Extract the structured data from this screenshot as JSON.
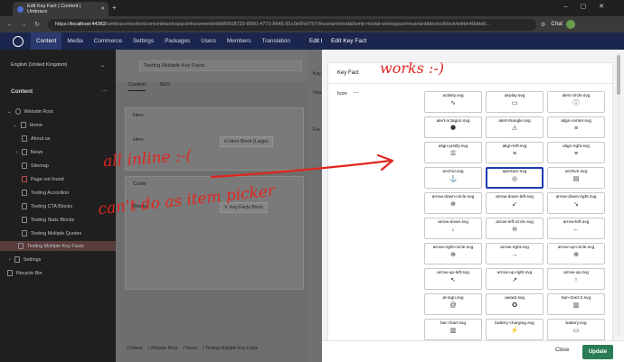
{
  "browser": {
    "tab_title": "Edit Key Fact | Content | Umbraco",
    "url_scheme": "https://",
    "url_host": "localhost:44362",
    "url_path": "/umbraco/section/content/workspace/document/edit/80508729-8560-4772-8646-81c0e5fe9707/invariant/modal/umb-modal-workspace/invariant/blocks/block/edit/e40dda6...",
    "chat_label": "Chat"
  },
  "header": {
    "sections": [
      "Content",
      "Media",
      "Commerce",
      "Settings",
      "Packages",
      "Users",
      "Members",
      "Translation"
    ],
    "active_section": "Content",
    "underlying_title": "Edit K"
  },
  "tree": {
    "culture": "English (United Kingdom)",
    "title": "Content",
    "nodes": [
      {
        "label": "Website Root",
        "level": 0
      },
      {
        "label": "Home",
        "level": 1
      },
      {
        "label": "About us",
        "level": 2
      },
      {
        "label": "News",
        "level": 2
      },
      {
        "label": "Sitemap",
        "level": 2
      },
      {
        "label": "Page not found",
        "level": 2
      },
      {
        "label": "Testing Accordion",
        "level": 2
      },
      {
        "label": "Testing CTA Blocks",
        "level": 2
      },
      {
        "label": "Testing Stats Blocks",
        "level": 2
      },
      {
        "label": "Testing Multiple Quotes",
        "level": 2
      },
      {
        "label": "Testing Multiple Key Facts",
        "level": 2
      },
      {
        "label": "Settings",
        "level": 1
      },
      {
        "label": "Recycle Bin",
        "level": 0
      }
    ],
    "selected": "Testing Multiple Key Facts"
  },
  "editor": {
    "document_name": "Testing Multiple Key Facts",
    "tabs": [
      "Content",
      "SEO"
    ],
    "hero_group": "Hero",
    "hero_label": "Hero",
    "hero_block": "Hero Block (Large)",
    "content_group": "Conte",
    "blocks_label": "Blocks",
    "blocks_block": "Key Facts Block",
    "breadcrumbs": [
      "Content",
      "Website Root",
      "Home",
      "Testing Multiple Key Facts"
    ],
    "right_labels": [
      "Key",
      "Hea",
      "Fac"
    ]
  },
  "modal": {
    "title": "Edit Key Fact",
    "card_title": "Key Fact",
    "icon_label": "Icon",
    "icons": [
      {
        "name": "activity.svg",
        "glyph": "∿"
      },
      {
        "name": "airplay.svg",
        "glyph": "▭"
      },
      {
        "name": "alert-circle.svg",
        "glyph": "ⓘ"
      },
      {
        "name": "alert-octagon.svg",
        "glyph": "⯃"
      },
      {
        "name": "alert-triangle.svg",
        "glyph": "⚠"
      },
      {
        "name": "align-center.svg",
        "glyph": "≡"
      },
      {
        "name": "align-justify.svg",
        "glyph": "☰"
      },
      {
        "name": "align-left.svg",
        "glyph": "≡"
      },
      {
        "name": "align-right.svg",
        "glyph": "≡"
      },
      {
        "name": "anchor.svg",
        "glyph": "⚓"
      },
      {
        "name": "aperture.svg",
        "glyph": "◎"
      },
      {
        "name": "archive.svg",
        "glyph": "▤"
      },
      {
        "name": "arrow-down-circle.svg",
        "glyph": "⊕"
      },
      {
        "name": "arrow-down-left.svg",
        "glyph": "↙"
      },
      {
        "name": "arrow-down-right.svg",
        "glyph": "↘"
      },
      {
        "name": "arrow-down.svg",
        "glyph": "↓"
      },
      {
        "name": "arrow-left-circle.svg",
        "glyph": "⊖"
      },
      {
        "name": "arrow-left.svg",
        "glyph": "←"
      },
      {
        "name": "arrow-right-circle.svg",
        "glyph": "⊕"
      },
      {
        "name": "arrow-right.svg",
        "glyph": "→"
      },
      {
        "name": "arrow-up-circle.svg",
        "glyph": "⊕"
      },
      {
        "name": "arrow-up-left.svg",
        "glyph": "↖"
      },
      {
        "name": "arrow-up-right.svg",
        "glyph": "↗"
      },
      {
        "name": "arrow-up.svg",
        "glyph": "↑"
      },
      {
        "name": "at-sign.svg",
        "glyph": "@"
      },
      {
        "name": "award.svg",
        "glyph": "✪"
      },
      {
        "name": "bar-chart-2.svg",
        "glyph": "▥"
      },
      {
        "name": "bar-chart.svg",
        "glyph": "▥"
      },
      {
        "name": "battery-charging.svg",
        "glyph": "⚡"
      },
      {
        "name": "battery.svg",
        "glyph": "▭"
      },
      {
        "name": "bell-off.svg",
        "glyph": "🔕"
      },
      {
        "name": "bell.svg",
        "glyph": "🔔"
      },
      {
        "name": "bluetooth.svg",
        "glyph": "ᛒ"
      }
    ],
    "selected_icon": "aperture.svg",
    "close_label": "Close",
    "update_label": "Update"
  },
  "annotations": {
    "works": "works :-)",
    "all_inline": "all inline :-(",
    "cant_do": "can't do as item picker",
    "color": "#e0261f"
  },
  "colors": {
    "header_bg": "#1b264f",
    "update_btn": "#2a7c55",
    "selected_border": "#1b3bb0"
  }
}
